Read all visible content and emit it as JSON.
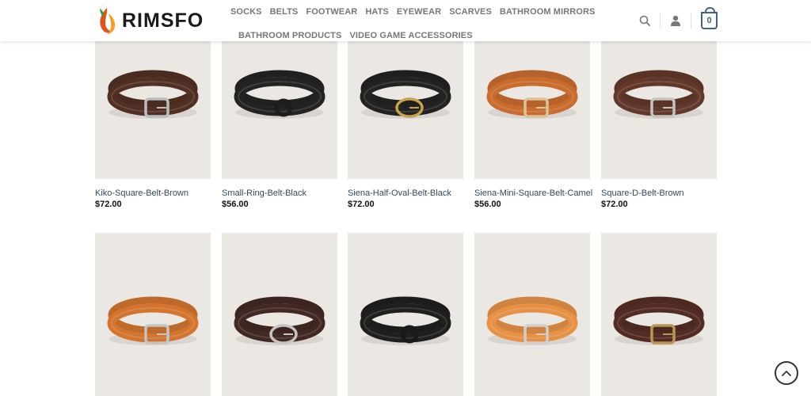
{
  "brand": {
    "name": "RIMSFO",
    "logo_icon": "leaf-flame-logo"
  },
  "nav": {
    "row1": [
      "SOCKS",
      "BELTS",
      "FOOTWEAR",
      "HATS",
      "EYEWEAR",
      "SCARVES",
      "BATHROOM MIRRORS"
    ],
    "row2": [
      "BATHROOM PRODUCTS",
      "VIDEO GAME ACCESSORIES"
    ]
  },
  "header": {
    "search_icon": "search-icon",
    "account_icon": "user-icon",
    "cart_count": "0"
  },
  "products_row1": [
    {
      "title": "Kiko-Square-Belt-Brown",
      "price": "$72.00",
      "belt_color": "#4a2b20",
      "buckle": "square",
      "buckle_color": "#bdbdbd"
    },
    {
      "title": "Small-Ring-Belt-Black",
      "price": "$56.00",
      "belt_color": "#202020",
      "buckle": "ring",
      "buckle_color": "#1d1d1d"
    },
    {
      "title": "Siena-Half-Oval-Belt-Black",
      "price": "$72.00",
      "belt_color": "#1f1f1f",
      "buckle": "oval",
      "buckle_color": "#c9a34a"
    },
    {
      "title": "Siena-Mini-Square-Belt-Camel",
      "price": "$56.00",
      "belt_color": "#b7622a",
      "buckle": "square",
      "buckle_color": "#d8c49a"
    },
    {
      "title": "Square-D-Belt-Brown",
      "price": "$72.00",
      "belt_color": "#5a3326",
      "buckle": "square",
      "buckle_color": "#c4c4c4"
    }
  ],
  "products_row2": [
    {
      "belt_color": "#c06a2a",
      "buckle": "square",
      "buckle_color": "#c4c4c4"
    },
    {
      "belt_color": "#3c2420",
      "buckle": "oval",
      "buckle_color": "#c4c4c4"
    },
    {
      "belt_color": "#1c1c1c",
      "buckle": "ring",
      "buckle_color": "#1a1a1a"
    },
    {
      "belt_color": "#d18440",
      "buckle": "square",
      "buckle_color": "#cfcfcf"
    },
    {
      "belt_color": "#4b2820",
      "buckle": "square",
      "buckle_color": "#b99655"
    }
  ],
  "back_to_top_icon": "chevron-up-icon",
  "colors": {
    "link": "#334862",
    "accent": "#446084",
    "image_bg": "#ebe7e3"
  }
}
